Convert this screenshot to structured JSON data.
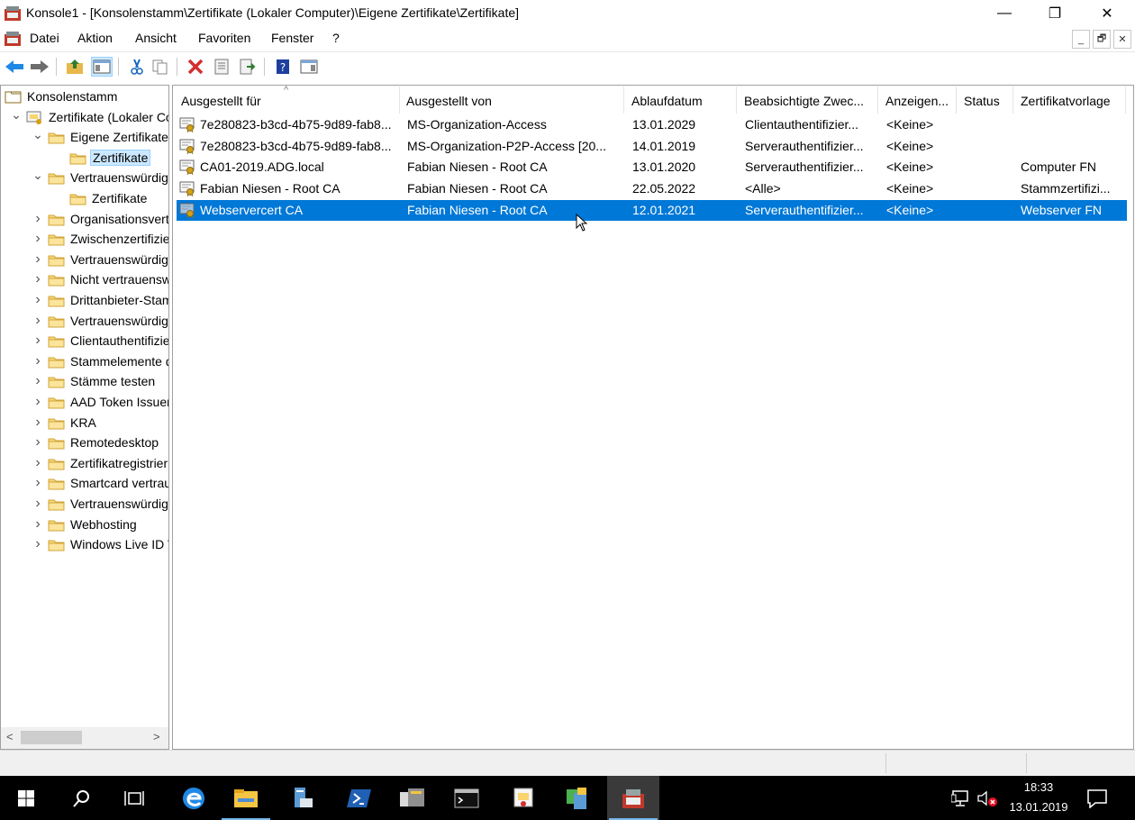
{
  "window": {
    "title": "Konsole1 - [Konsolenstamm\\Zertifikate (Lokaler Computer)\\Eigene Zertifikate\\Zertifikate]",
    "minimize_glyph": "—",
    "maximize_glyph": "❐",
    "close_glyph": "✕"
  },
  "menu": {
    "items": [
      "Datei",
      "Aktion",
      "Ansicht",
      "Favoriten",
      "Fenster",
      "?"
    ],
    "mdi_min": "_",
    "mdi_restore": "🗗",
    "mdi_close": "✕"
  },
  "toolbar": {
    "buttons": [
      "back-icon",
      "forward-icon",
      "up-folder-icon",
      "show-hide-tree-icon",
      "cut-icon",
      "copy-icon",
      "delete-icon",
      "properties-icon",
      "export-list-icon",
      "help-icon",
      "action-pane-icon"
    ]
  },
  "tree": {
    "items": [
      {
        "label": "Konsolenstamm",
        "level": 0,
        "expander": ""
      },
      {
        "label": "Zertifikate (Lokaler Computer)",
        "level": 1,
        "expander": "open"
      },
      {
        "label": "Eigene Zertifikate",
        "level": 2,
        "expander": "open"
      },
      {
        "label": "Zertifikate",
        "level": 3,
        "expander": "",
        "selected": true
      },
      {
        "label": "Vertrauenswürdige Stammzertifizierungsstellen",
        "level": 2,
        "expander": "open"
      },
      {
        "label": "Zertifikate",
        "level": 3,
        "expander": ""
      },
      {
        "label": "Organisationsvertrauen",
        "level": 2,
        "expander": "closed"
      },
      {
        "label": "Zwischenzertifizierungsstellen",
        "level": 2,
        "expander": "closed"
      },
      {
        "label": "Vertrauenswürdige Herausgeber",
        "level": 2,
        "expander": "closed"
      },
      {
        "label": "Nicht vertrauenswürdige Zertifikate",
        "level": 2,
        "expander": "closed"
      },
      {
        "label": "Drittanbieter-Stammzertifizierungsstellen",
        "level": 2,
        "expander": "closed"
      },
      {
        "label": "Vertrauenswürdige Personen",
        "level": 2,
        "expander": "closed"
      },
      {
        "label": "Clientauthentifizierungsaussteller",
        "level": 2,
        "expander": "closed"
      },
      {
        "label": "Stammelemente der Vorschau",
        "level": 2,
        "expander": "closed"
      },
      {
        "label": "Stämme testen",
        "level": 2,
        "expander": "closed"
      },
      {
        "label": "AAD Token Issuer",
        "level": 2,
        "expander": "closed"
      },
      {
        "label": "KRA",
        "level": 2,
        "expander": "closed"
      },
      {
        "label": "Remotedesktop",
        "level": 2,
        "expander": "closed"
      },
      {
        "label": "Zertifikatregistrierungsanforderungen",
        "level": 2,
        "expander": "closed"
      },
      {
        "label": "Smartcard vertrauenswürdige Stämme",
        "level": 2,
        "expander": "closed"
      },
      {
        "label": "Vertrauenswürdige Geräte",
        "level": 2,
        "expander": "closed"
      },
      {
        "label": "Webhosting",
        "level": 2,
        "expander": "closed"
      },
      {
        "label": "Windows Live ID Token Issuer",
        "level": 2,
        "expander": "closed"
      }
    ],
    "scroll_left_glyph": "<",
    "scroll_right_glyph": ">"
  },
  "list": {
    "sort_glyph": "^",
    "columns": [
      "Ausgestellt für",
      "Ausgestellt von",
      "Ablaufdatum",
      "Beabsichtigte Zwec...",
      "Anzeigen...",
      "Status",
      "Zertifikatvorlage"
    ],
    "rows": [
      {
        "issued_to": "7e280823-b3cd-4b75-9d89-fab8...",
        "issued_by": "MS-Organization-Access",
        "expires": "13.01.2029",
        "purpose": "Clientauthentifizier...",
        "friendly": "<Keine>",
        "status": "",
        "template": ""
      },
      {
        "issued_to": "7e280823-b3cd-4b75-9d89-fab8...",
        "issued_by": "MS-Organization-P2P-Access [20...",
        "expires": "14.01.2019",
        "purpose": "Serverauthentifizier...",
        "friendly": "<Keine>",
        "status": "",
        "template": ""
      },
      {
        "issued_to": "CA01-2019.ADG.local",
        "issued_by": "Fabian Niesen - Root CA",
        "expires": "13.01.2020",
        "purpose": "Serverauthentifizier...",
        "friendly": "<Keine>",
        "status": "",
        "template": "Computer FN"
      },
      {
        "issued_to": "Fabian Niesen - Root CA",
        "issued_by": "Fabian Niesen - Root CA",
        "expires": "22.05.2022",
        "purpose": "<Alle>",
        "friendly": "<Keine>",
        "status": "",
        "template": "Stammzertifizi..."
      },
      {
        "issued_to": "Webservercert CA",
        "issued_by": "Fabian Niesen - Root CA",
        "expires": "12.01.2021",
        "purpose": "Serverauthentifizier...",
        "friendly": "<Keine>",
        "status": "",
        "template": "Webserver FN",
        "selected": true
      }
    ]
  },
  "taskbar": {
    "apps": [
      "start-icon",
      "search-icon",
      "task-view-icon",
      "edge-icon",
      "file-explorer-icon",
      "server-manager-icon",
      "powershell-icon",
      "file-share-icon",
      "cmd-icon",
      "certificate-app-icon",
      "network-mmc-icon",
      "mmc-console-icon"
    ],
    "time": "18:33",
    "date": "13.01.2019"
  },
  "colors": {
    "selection": "#0078d7",
    "tree_selection": "#cce8ff",
    "taskbar": "#000000",
    "accent": "#76b9ed"
  }
}
